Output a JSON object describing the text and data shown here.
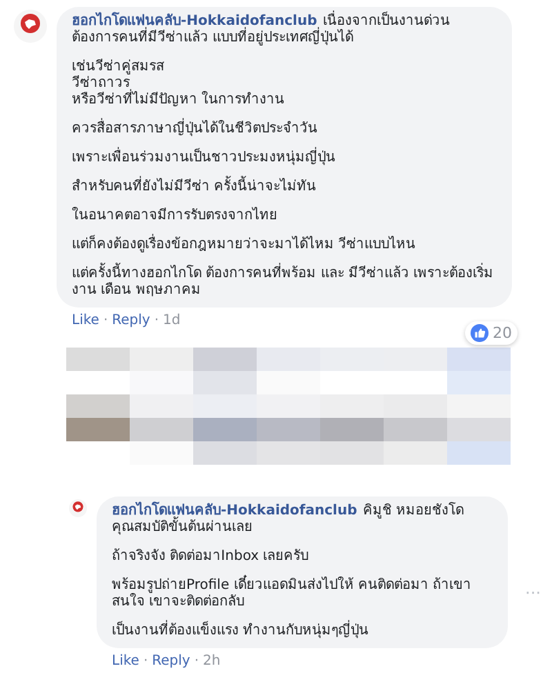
{
  "comments": [
    {
      "author": "ฮอกไกโดแฟนคลับ-Hokkaidofanclub",
      "paragraphs": [
        [
          "เนื่องจากเป็นงานด่วน ต้องการคนที่มีวีซ่าแล้ว แบบที่อยู่ประเทศญี่ปุ่นได้"
        ],
        [
          "เช่นวีซ่าคู่สมรส",
          "วีซ่าถาวร",
          "หรือวีซ่าที่ไม่มีปัญหา ในการทำงาน"
        ],
        [
          "ควรสื่อสารภาษาญี่ปุ่นได้ในชีวิตประจำวัน"
        ],
        [
          "เพราะเพื่อนร่วมงานเป็นชาวประมงหนุ่มญี่ปุ่น"
        ],
        [
          "สำหรับคนที่ยังไม่มีวีซ่า ครั้งนี้น่าจะไม่ทัน"
        ],
        [
          "ในอนาคตอาจมีการรับตรงจากไทย"
        ],
        [
          "แต่ก็คงต้องดูเรื่องข้อกฎหมายว่าจะมาได้ไหม วีซ่าแบบไหน"
        ],
        [
          "แต่ครั้งนี้ทางฮอกไกโด ต้องการคนที่พร้อม และ มีวีซ่าแล้ว เพราะต้องเริ่มงาน เดือน พฤษภาคม"
        ]
      ],
      "reactions": "20",
      "separator": "·",
      "actions": [
        "Like",
        "Reply",
        "1d"
      ]
    },
    {
      "kind": "picture"
    },
    {
      "author": "ฮอกไกโดแฟนคลับ-Hokkaidofanclub",
      "paragraphs": [
        [
          "คิมูชิ หมอยชังโด คุณสมบัติขั้นต้นผ่านเลย"
        ],
        [
          "ถ้าจริงจัง ติดต่อมาInbox เลยครับ"
        ],
        [
          "พร้อมรูปถ่ายProfile เดี๋ยวแอดมินส่งไปให้ คนติดต่อมา ถ้าเขาสนใจ เขาจะติดต่อกลับ"
        ],
        [
          "เป็นงานที่ต้องแข็งแรง ทำงานกับหนุ่มๆญี่ปุ่น"
        ]
      ],
      "more": "···",
      "separator": "·",
      "actions": [
        "Like",
        "Reply",
        "2h"
      ]
    }
  ]
}
